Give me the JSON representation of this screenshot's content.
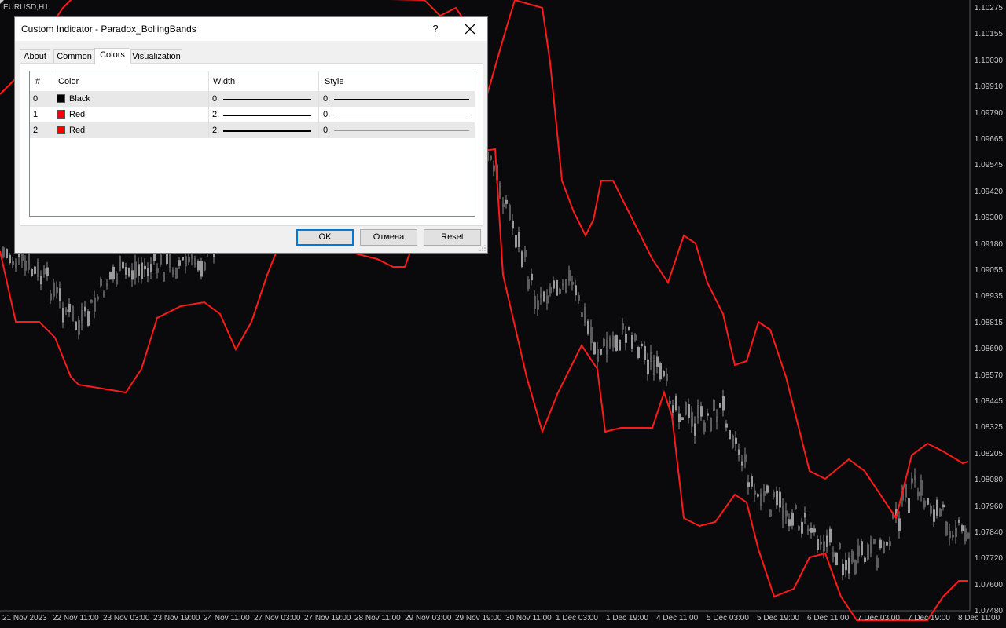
{
  "chart": {
    "symbol": "EURUSD,H1",
    "price_labels": [
      "1.10275",
      "1.10155",
      "1.10030",
      "1.09910",
      "1.09790",
      "1.09665",
      "1.09545",
      "1.09420",
      "1.09300",
      "1.09180",
      "1.09055",
      "1.08935",
      "1.08815",
      "1.08690",
      "1.08570",
      "1.08445",
      "1.08325",
      "1.08205",
      "1.08080",
      "1.07960",
      "1.07840",
      "1.07720",
      "1.07600",
      "1.07480"
    ],
    "time_labels": [
      "21 Nov 2023",
      "22 Nov 11:00",
      "23 Nov 03:00",
      "23 Nov 19:00",
      "24 Nov 11:00",
      "27 Nov 03:00",
      "27 Nov 19:00",
      "28 Nov 11:00",
      "29 Nov 03:00",
      "29 Nov 19:00",
      "30 Nov 11:00",
      "1 Dec 03:00",
      "1 Dec 19:00",
      "4 Dec 11:00",
      "5 Dec 03:00",
      "5 Dec 19:00",
      "6 Dec 11:00",
      "7 Dec 03:00",
      "7 Dec 19:00",
      "8 Dec 11:00"
    ],
    "colors": {
      "background": "#0a0a0c",
      "band": "#ff1a1a",
      "candle": "#9a9a9a",
      "text": "#c8c8c8"
    }
  },
  "dialog": {
    "title": "Custom Indicator - Paradox_BollingBands",
    "help": "?",
    "close_icon": "close-icon",
    "tabs": [
      {
        "label": "About",
        "active": false
      },
      {
        "label": "Common",
        "active": false
      },
      {
        "label": "Colors",
        "active": true
      },
      {
        "label": "Visualization",
        "active": false
      }
    ],
    "columns": [
      "#",
      "Color",
      "Width",
      "Style"
    ],
    "rows": [
      {
        "index": "0",
        "color_name": "Black",
        "swatch": "#000000",
        "width": "0.",
        "style": "0."
      },
      {
        "index": "1",
        "color_name": "Red",
        "swatch": "#ff0000",
        "width": "2.",
        "style": "0."
      },
      {
        "index": "2",
        "color_name": "Red",
        "swatch": "#ff0000",
        "width": "2.",
        "style": "0."
      }
    ],
    "buttons": {
      "ok": "OK",
      "cancel": "Отмена",
      "reset": "Reset"
    },
    "accent": "#0078d7"
  }
}
